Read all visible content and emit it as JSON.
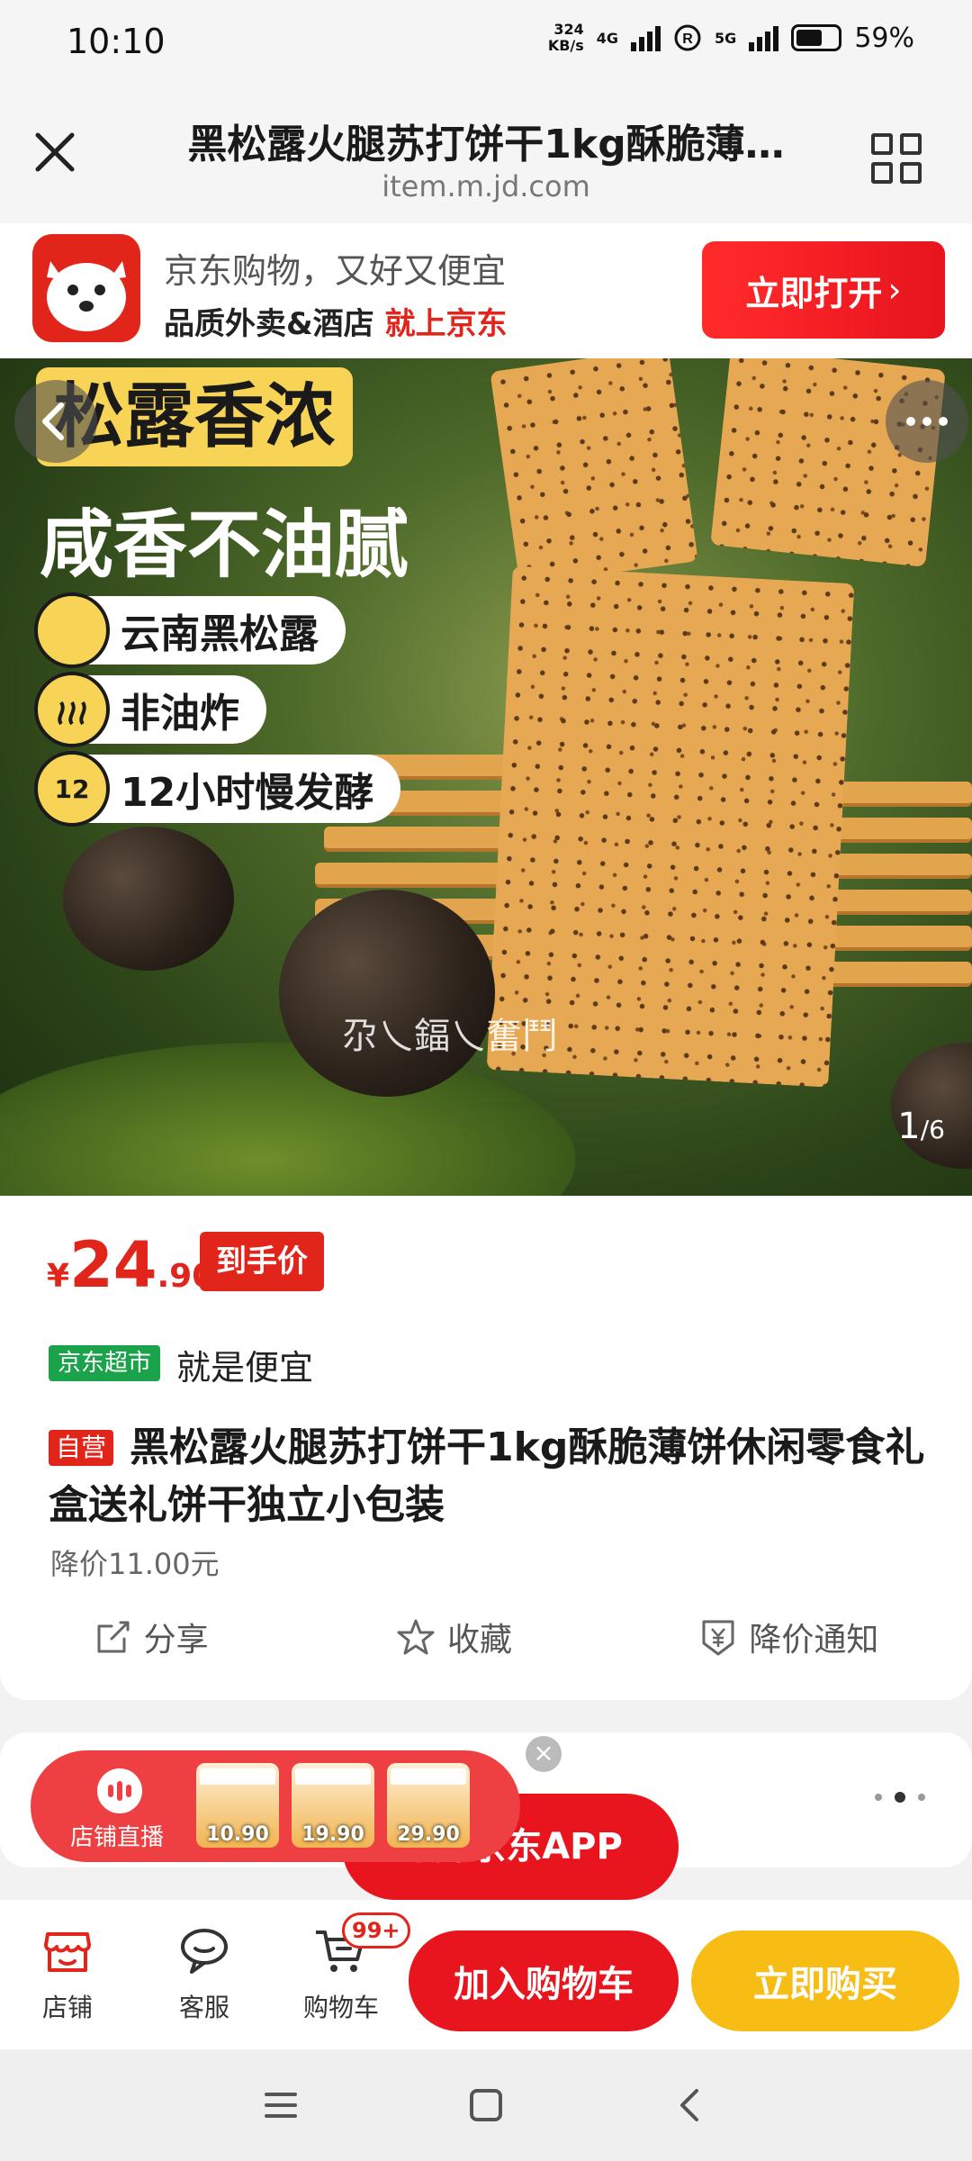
{
  "status_bar": {
    "time": "10:10",
    "net_speed_value": "324",
    "net_speed_unit": "KB/s",
    "network_1": "4G",
    "network_2": "5G",
    "battery": "59%"
  },
  "title_bar": {
    "title": "黑松露火腿苏打饼干1kg酥脆薄…",
    "url": "item.m.jd.com"
  },
  "app_banner": {
    "line1": "京东购物，又好又便宜",
    "line2_prefix": "品质外卖&酒店",
    "line2_highlight": "就上京东",
    "open_button": "立即打开"
  },
  "hero": {
    "headline1": "松露香浓",
    "headline2": "咸香不油腻",
    "features": [
      {
        "icon_text": "",
        "label": "云南黑松露"
      },
      {
        "icon_text": "",
        "label": "非油炸"
      },
      {
        "icon_text": "12",
        "label": "12小时慢发酵"
      }
    ],
    "watermark": "尕乀鍢乀奮鬥",
    "pager_current": "1",
    "pager_total": "/6"
  },
  "product": {
    "currency": "¥",
    "price_int": "24",
    "price_dec": ".90",
    "price_tag": "到手价",
    "store_badge": "京东超市",
    "store_slogan": "就是便宜",
    "self_badge": "自营",
    "title": "黑松露火腿苏打饼干1kg酥脆薄饼休闲零食礼盒送礼饼干独立小包装",
    "price_drop": "降价11.00元",
    "actions": {
      "share": "分享",
      "favorite": "收藏",
      "price_alert": "降价通知"
    }
  },
  "live_bar": {
    "label": "店铺直播",
    "items": [
      {
        "price": "10.90"
      },
      {
        "price": "19.90"
      },
      {
        "price": "29.90"
      }
    ]
  },
  "open_app_button": "打开京东APP",
  "bottom_bar": {
    "shop": "店铺",
    "service": "客服",
    "cart": "购物车",
    "cart_badge": "99+",
    "add_to_cart": "加入购物车",
    "buy_now": "立即购买"
  },
  "colors": {
    "brand_red": "#e1251b",
    "buy_yellow": "#f8bd14",
    "supermarket_green": "#1aa34a"
  }
}
